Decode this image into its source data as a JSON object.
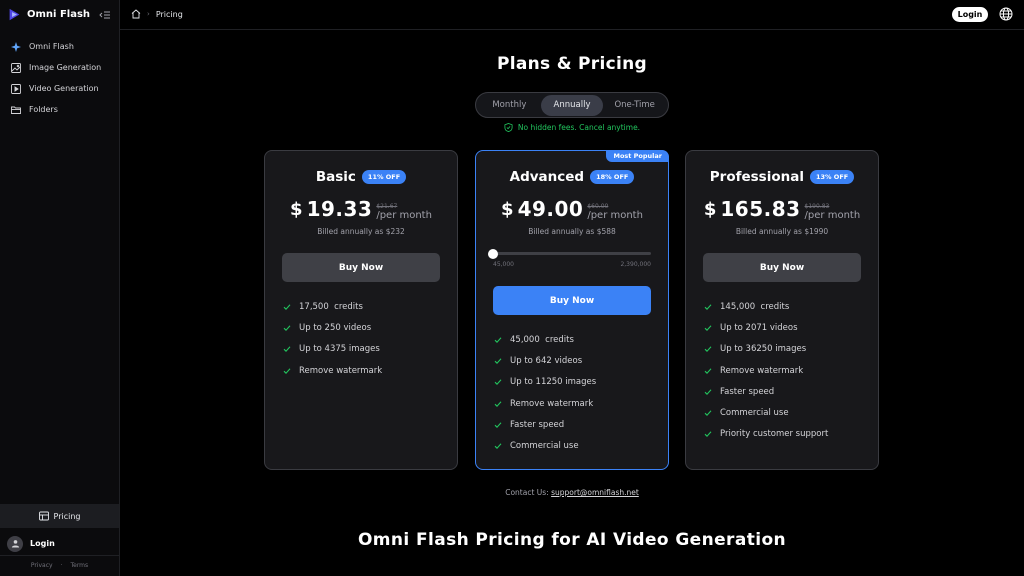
{
  "colors": {
    "accent": "#3b82f6",
    "success": "#22c55e",
    "background": "#000000",
    "card": "#18181b"
  },
  "sidebar": {
    "brand": "Omni Flash",
    "items": [
      {
        "label": "Omni Flash",
        "icon": "sparkle-icon"
      },
      {
        "label": "Image Generation",
        "icon": "image-icon"
      },
      {
        "label": "Video Generation",
        "icon": "video-icon"
      },
      {
        "label": "Folders",
        "icon": "folder-icon"
      }
    ],
    "pricing_label": "Pricing",
    "login_label": "Login",
    "footer": {
      "privacy": "Privacy",
      "terms": "Terms"
    }
  },
  "topbar": {
    "breadcrumb_current": "Pricing",
    "login_button": "Login"
  },
  "main": {
    "title": "Plans & Pricing",
    "billing_tabs": [
      "Monthly",
      "Annually",
      "One-Time"
    ],
    "active_tab": "Annually",
    "note": "No hidden fees. Cancel anytime.",
    "contact_prefix": "Contact Us:",
    "contact_email": "support@omniflash.net",
    "bottom_title": "Omni Flash Pricing for AI Video Generation"
  },
  "plans": [
    {
      "name": "Basic",
      "badge": "11% OFF",
      "currency": "$",
      "price": "19.33",
      "old_price": "$21.67",
      "period": "/per month",
      "billed": "Billed annually as $232",
      "button": "Buy Now",
      "features": [
        "17,500  credits",
        "Up to 250 videos",
        "Up to 4375 images",
        "Remove watermark"
      ]
    },
    {
      "name": "Advanced",
      "badge": "18% OFF",
      "ribbon": "Most Popular",
      "currency": "$",
      "price": "49.00",
      "old_price": "$60.00",
      "period": "/per month",
      "billed": "Billed annually as $588",
      "button": "Buy Now",
      "slider": {
        "min": "45,000",
        "max": "2,390,000",
        "value": 0
      },
      "features": [
        "45,000  credits",
        "Up to 642 videos",
        "Up to 11250 images",
        "Remove watermark",
        "Faster speed",
        "Commercial use"
      ]
    },
    {
      "name": "Professional",
      "badge": "13% OFF",
      "currency": "$",
      "price": "165.83",
      "old_price": "$190.83",
      "period": "/per month",
      "billed": "Billed annually as $1990",
      "button": "Buy Now",
      "features": [
        "145,000  credits",
        "Up to 2071 videos",
        "Up to 36250 images",
        "Remove watermark",
        "Faster speed",
        "Commercial use",
        "Priority customer support"
      ]
    }
  ]
}
